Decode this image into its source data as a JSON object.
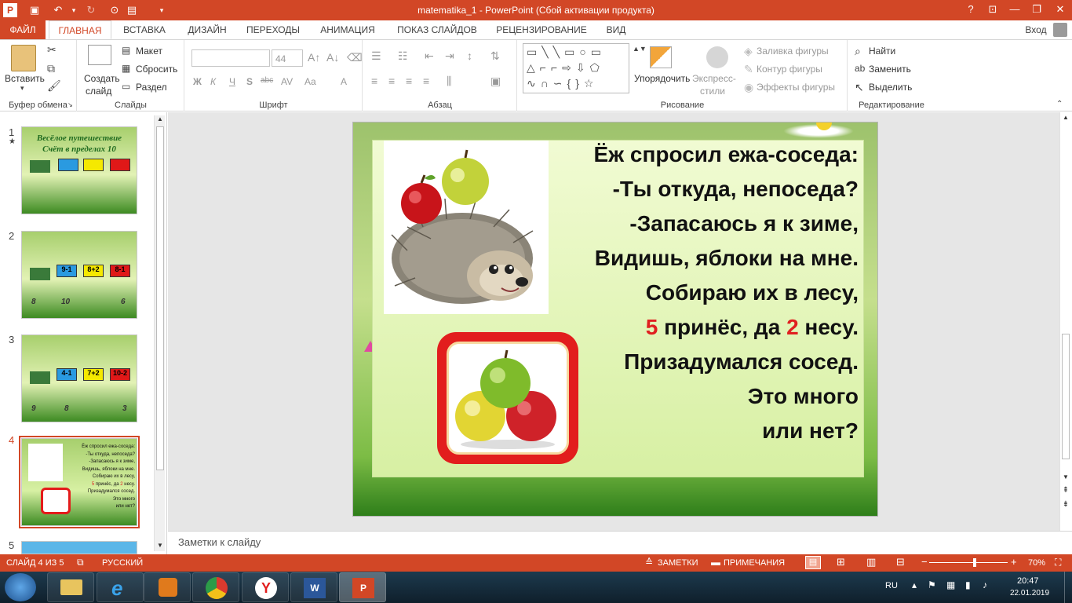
{
  "window": {
    "title": "matematika_1 - PowerPoint (Сбой активации продукта)",
    "help": "?",
    "restore_ribbon": "⊡",
    "minimize": "—",
    "maximize": "❐",
    "close": "✕"
  },
  "tabs": {
    "file": "ФАЙЛ",
    "home": "ГЛАВНАЯ",
    "insert": "ВСТАВКА",
    "design": "ДИЗАЙН",
    "transitions": "ПЕРЕХОДЫ",
    "animation": "АНИМАЦИЯ",
    "slideshow": "ПОКАЗ СЛАЙДОВ",
    "review": "РЕЦЕНЗИРОВАНИЕ",
    "view": "ВИД",
    "signin": "Вход"
  },
  "ribbon": {
    "clipboard": {
      "label": "Буфер обмена",
      "paste": "Вставить"
    },
    "slides": {
      "label": "Слайды",
      "new_slide_1": "Создать",
      "new_slide_2": "слайд",
      "layout": "Макет",
      "reset": "Сбросить",
      "section": "Раздел"
    },
    "font": {
      "label": "Шрифт",
      "font_size": "44",
      "bold": "Ж",
      "italic": "К",
      "underline": "Ч",
      "shadow": "S",
      "strike": "abc",
      "spacing": "AV",
      "case": "Aa",
      "color": "A"
    },
    "paragraph": {
      "label": "Абзац"
    },
    "drawing": {
      "label": "Рисование",
      "arrange": "Упорядочить",
      "quick_styles_1": "Экспресс-",
      "quick_styles_2": "стили",
      "fill": "Заливка фигуры",
      "outline": "Контур фигуры",
      "effects": "Эффекты фигуры"
    },
    "editing": {
      "label": "Редактирование",
      "find": "Найти",
      "replace": "Заменить",
      "select": "Выделить"
    }
  },
  "thumbnails": [
    {
      "num": "1",
      "star": "★",
      "title1": "Весёлое путешествие",
      "title2": "Счёт в пределах 10"
    },
    {
      "num": "2",
      "labels": [
        "9-1",
        "8+2",
        "8-1"
      ],
      "animals": [
        "8",
        "10",
        "6"
      ]
    },
    {
      "num": "3",
      "labels": [
        "4-1",
        "7+2",
        "10-2"
      ],
      "animals": [
        "9",
        "8",
        "3"
      ]
    },
    {
      "num": "4",
      "selected": true
    },
    {
      "num": "5"
    }
  ],
  "slide": {
    "lines": [
      "Ёж спросил ежа-соседа:",
      "-Ты откуда, непоседа?",
      "-Запасаюсь я к зиме,",
      "Видишь, яблоки на мне.",
      "Собираю их в лесу,"
    ],
    "line6": {
      "n1": "5",
      "mid": " принёс, да ",
      "n2": "2",
      "end": " несу."
    },
    "lines_end": [
      "Призадумался сосед.",
      "Это много",
      "или нет?"
    ]
  },
  "notes": {
    "placeholder": "Заметки к слайду"
  },
  "status": {
    "slide_info": "СЛАЙД 4 ИЗ 5",
    "language": "РУССКИЙ",
    "notes": "ЗАМЕТКИ",
    "comments": "ПРИМЕЧАНИЯ",
    "zoom": "70%",
    "zoom_level": 0.58
  },
  "taskbar": {
    "lang": "RU",
    "time": "20:47",
    "date": "22.01.2019"
  },
  "colors": {
    "accent": "#d24726",
    "taskbar": "#1d3a4e"
  }
}
